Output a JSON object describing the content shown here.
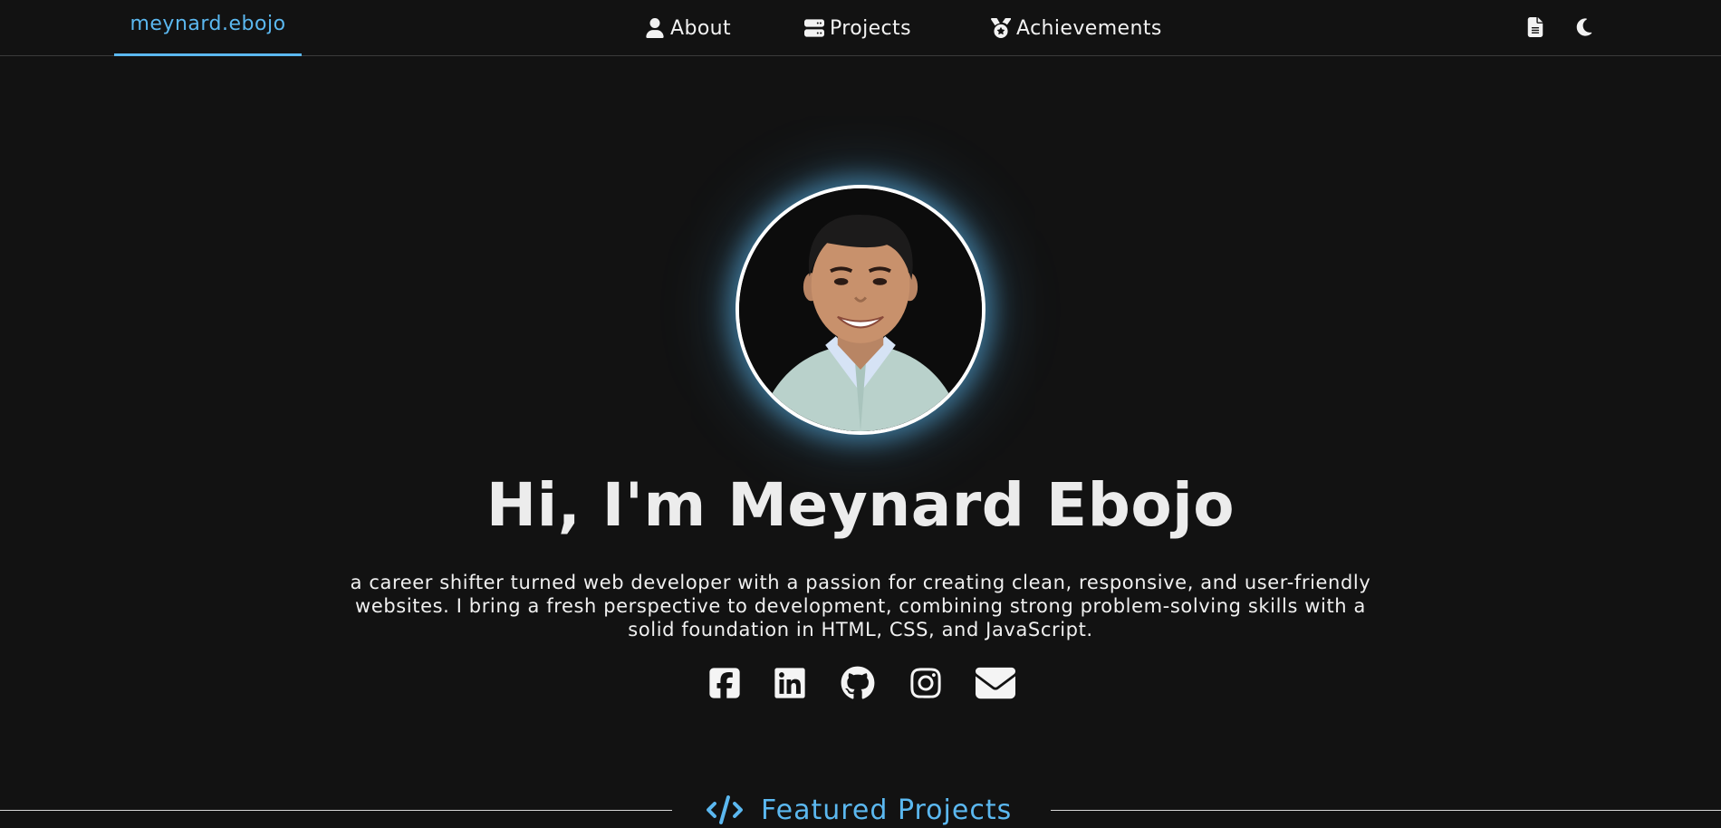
{
  "nav": {
    "brand": "meynard.ebojo",
    "links": [
      {
        "label": "About",
        "icon": "user-icon"
      },
      {
        "label": "Projects",
        "icon": "server-icon"
      },
      {
        "label": "Achievements",
        "icon": "medal-icon"
      }
    ],
    "utilities": [
      {
        "icon": "document-icon"
      },
      {
        "icon": "moon-icon"
      }
    ]
  },
  "hero": {
    "avatar_icon": "profile-photo",
    "title": "Hi, I'm Meynard Ebojo",
    "description": "a career shifter turned web developer with a passion for creating clean, responsive, and user-friendly websites. I bring a fresh perspective to development, combining strong problem-solving skills with a solid foundation in HTML, CSS, and JavaScript.",
    "socials": [
      {
        "icon": "facebook-icon"
      },
      {
        "icon": "linkedin-icon"
      },
      {
        "icon": "github-icon"
      },
      {
        "icon": "instagram-icon"
      },
      {
        "icon": "envelope-icon"
      }
    ]
  },
  "featured": {
    "icon": "code-icon",
    "heading": "Featured Projects"
  },
  "colors": {
    "background": "#121212",
    "accent": "#5bb8f0",
    "text": "#ececec"
  }
}
